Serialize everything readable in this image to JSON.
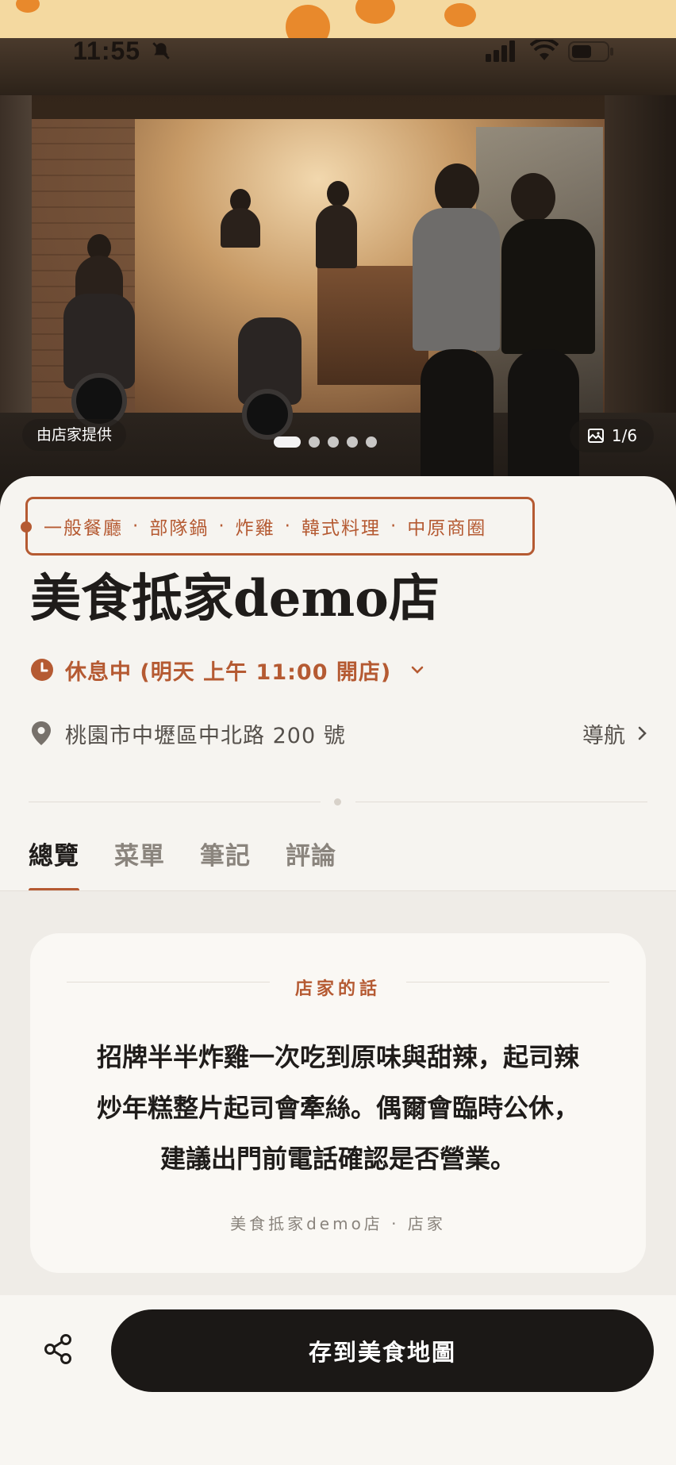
{
  "status_bar": {
    "time": "11:55"
  },
  "hero": {
    "credit": "由店家提供",
    "photo_counter": "1/6",
    "carousel": {
      "total": 6,
      "active_index": 0
    }
  },
  "tags": [
    "一般餐廳",
    "部隊鍋",
    "炸雞",
    "韓式料理",
    "中原商圈"
  ],
  "tag_separator": "·",
  "restaurant": {
    "name": "美食抵家demo店",
    "hours_status": "休息中 (明天 上午 11:00 開店)",
    "address": "桃園市中壢區中北路 200 號",
    "navigate_label": "導航"
  },
  "tabs": [
    {
      "label": "總覽",
      "active": true
    },
    {
      "label": "菜單",
      "active": false
    },
    {
      "label": "筆記",
      "active": false
    },
    {
      "label": "評論",
      "active": false
    }
  ],
  "owner_note": {
    "heading": "店家的話",
    "lines": [
      "招牌半半炸雞一次吃到原味與甜辣，起司辣",
      "炒年糕整片起司會牽絲。偶爾會臨時公休，",
      "建議出門前電話確認是否營業。"
    ],
    "signature": "美食抵家demo店 · 店家"
  },
  "actions": {
    "save_label": "存到美食地圖"
  },
  "colors": {
    "accent": "#b55a32",
    "button_dark": "#1b1816",
    "background": "#f6f4f0"
  },
  "icons": [
    "bell-off-icon",
    "signal-icon",
    "wifi-icon",
    "battery-icon",
    "gallery-icon",
    "clock-icon",
    "chevron-down-icon",
    "map-pin-icon",
    "chevron-right-icon",
    "share-icon"
  ]
}
